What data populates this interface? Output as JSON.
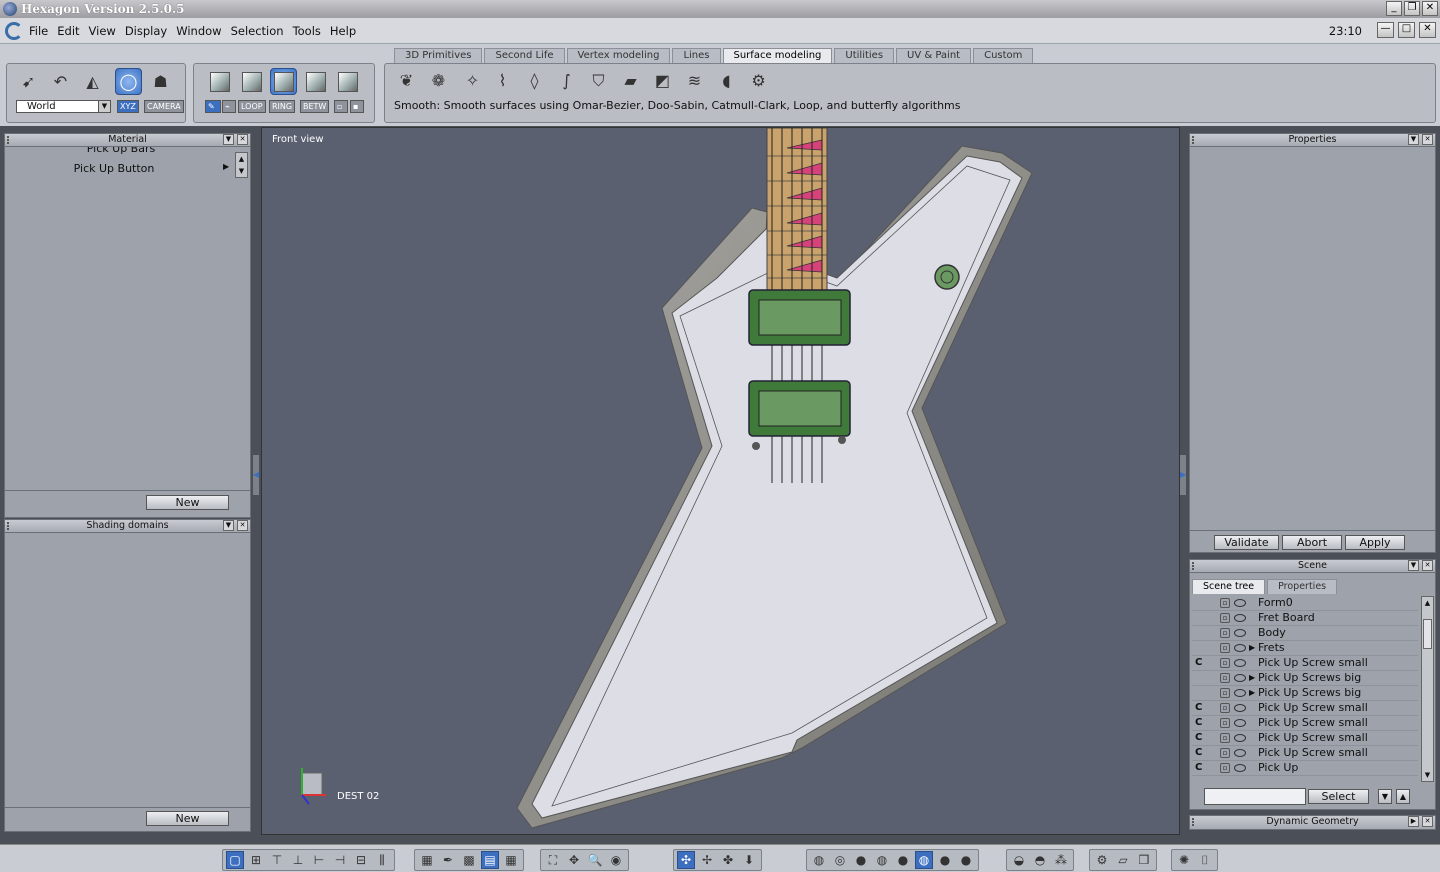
{
  "window": {
    "title": "Hexagon Version 2.5.0.5"
  },
  "menu": {
    "items": [
      "File",
      "Edit",
      "View",
      "Display",
      "Window",
      "Selection",
      "Tools",
      "Help"
    ],
    "clock": "23:10"
  },
  "tabs": [
    {
      "label": "3D Primitives",
      "active": false
    },
    {
      "label": "Second Life",
      "active": false
    },
    {
      "label": "Vertex modeling",
      "active": false
    },
    {
      "label": "Lines",
      "active": false
    },
    {
      "label": "Surface modeling",
      "active": true
    },
    {
      "label": "Utilities",
      "active": false
    },
    {
      "label": "UV & Paint",
      "active": false
    },
    {
      "label": "Custom",
      "active": false
    }
  ],
  "toolbar": {
    "coord_space": "World",
    "xyz_label": "XYZ",
    "camera_label": "CAMERA",
    "loop_label": "LOOP",
    "ring_label": "RING",
    "betw_label": "BETW",
    "tool_description": "Smooth: Smooth surfaces using Omar-Bezier, Doo-Sabin, Catmull-Clark, Loop, and butterfly algorithms"
  },
  "material_panel": {
    "title": "Material",
    "partial_item": "Pick Up Bars",
    "item": "Pick Up Button",
    "new_label": "New"
  },
  "shading_panel": {
    "title": "Shading domains",
    "new_label": "New"
  },
  "viewport": {
    "label": "Front view",
    "axis_label": "DEST 02"
  },
  "properties_panel": {
    "title": "Properties",
    "validate_label": "Validate",
    "abort_label": "Abort",
    "apply_label": "Apply"
  },
  "scene_panel": {
    "title": "Scene",
    "tabs": [
      "Scene tree",
      "Properties"
    ],
    "rows": [
      {
        "label": "Form0",
        "c": false,
        "expand": false
      },
      {
        "label": "Fret Board",
        "c": false,
        "expand": false
      },
      {
        "label": "Body",
        "c": false,
        "expand": false
      },
      {
        "label": "Frets",
        "c": false,
        "expand": true
      },
      {
        "label": "Pick Up Screw small",
        "c": true,
        "expand": false
      },
      {
        "label": "Pick Up Screws big",
        "c": false,
        "expand": true
      },
      {
        "label": "Pick Up Screws big",
        "c": false,
        "expand": true
      },
      {
        "label": "Pick Up Screw small",
        "c": true,
        "expand": false
      },
      {
        "label": "Pick Up Screw small",
        "c": true,
        "expand": false
      },
      {
        "label": "Pick Up Screw small",
        "c": true,
        "expand": false
      },
      {
        "label": "Pick Up Screw small",
        "c": true,
        "expand": false
      },
      {
        "label": "Pick Up",
        "c": true,
        "expand": false
      }
    ],
    "select_label": "Select"
  },
  "dynamic_panel": {
    "title": "Dynamic Geometry"
  }
}
